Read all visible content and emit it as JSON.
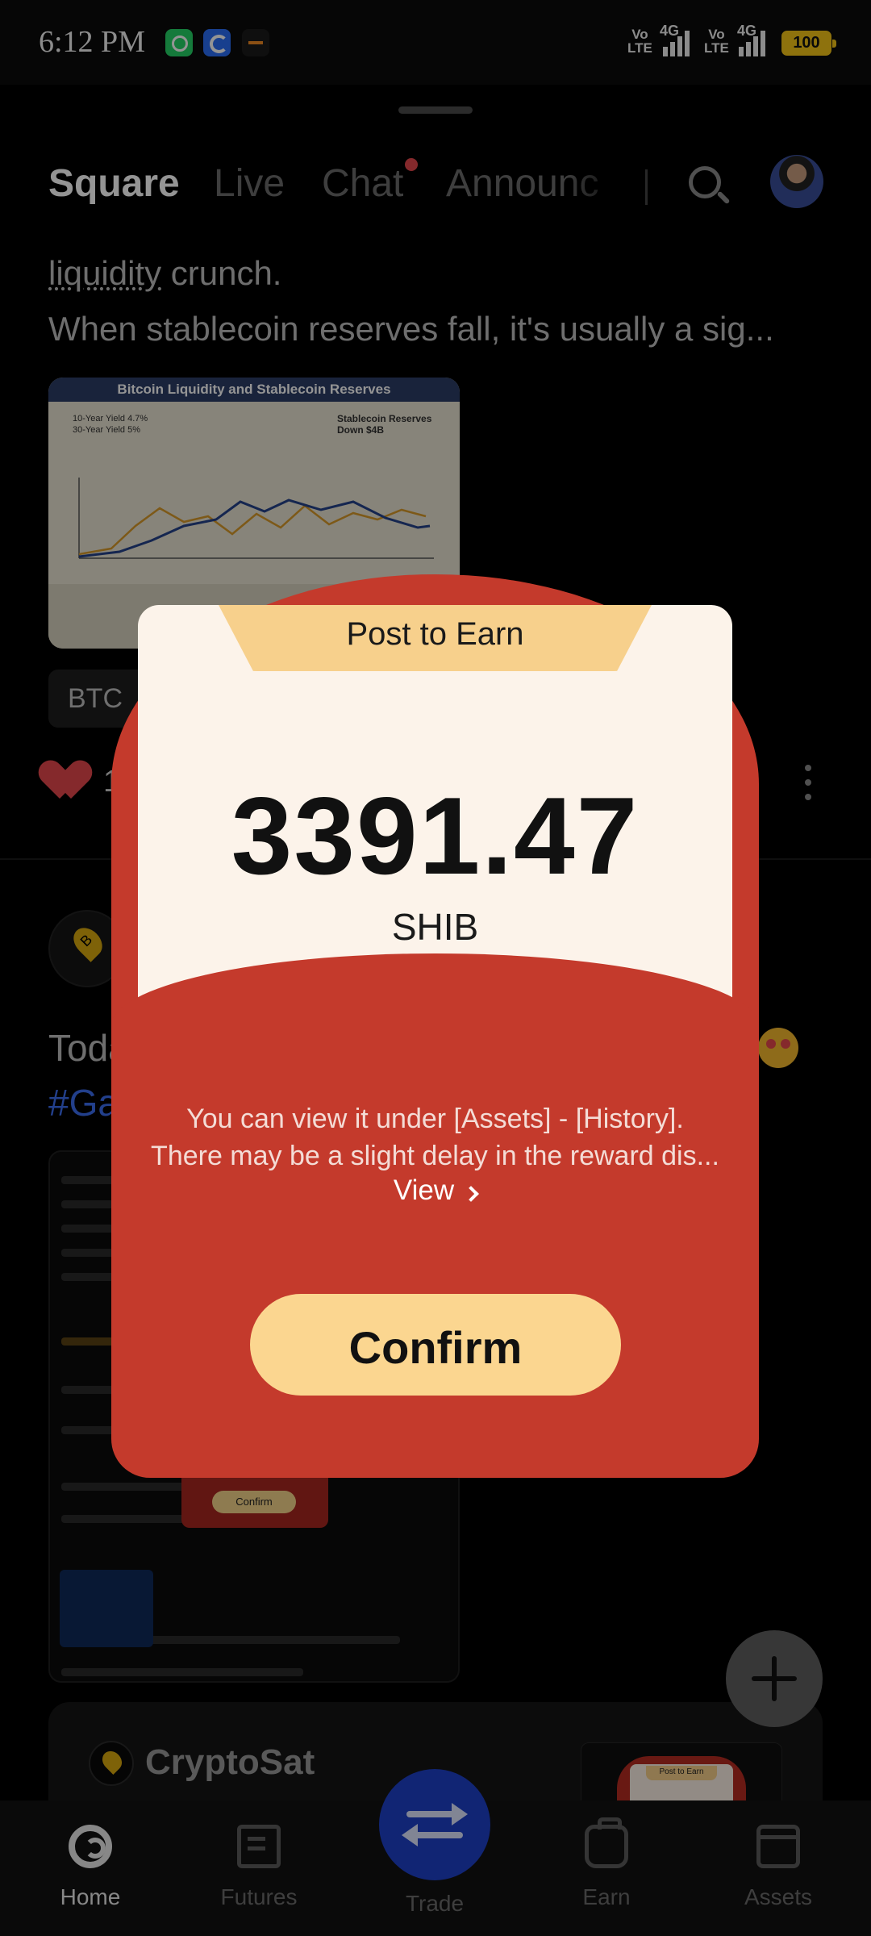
{
  "status_bar": {
    "time": "6:12 PM",
    "net1": "Vo\nLTE",
    "net2": "4G",
    "net3": "Vo\nLTE",
    "net4": "4G",
    "battery": "100"
  },
  "tabs": {
    "square": "Square",
    "live": "Live",
    "chat": "Chat",
    "announcements": "Announc"
  },
  "feed": {
    "post1_line1_underlined": "liquidity",
    "post1_line1_rest": " crunch.",
    "post1_line2": "When stablecoin reserves fall, it's usually a sig...",
    "image_title": "Bitcoin Liquidity and Stablecoin Reserves",
    "image_yields": "10-Year Yield 4.7%\n30-Year Yield 5%",
    "image_reserves": "Stablecoin Reserves\nDown $4B",
    "tag": "BTC",
    "like_count": "10",
    "post2_text": "Toda",
    "post2_hashtag": "#Ga",
    "mini_confirm": "Confirm",
    "card_name": "CryptoSat",
    "card_thumb_title": "Post to Earn"
  },
  "modal": {
    "title": "Post to Earn",
    "amount": "3391.47",
    "coin": "SHIB",
    "info_line1": "You can view it under [Assets] - [History].",
    "info_line2": "There may be a slight delay in the reward dis...",
    "view_label": "View",
    "confirm_label": "Confirm",
    "colors": {
      "envelope": "#c43a2c",
      "letter": "#fcf3ea",
      "tab": "#f7d08c",
      "button": "#fbd690"
    }
  },
  "bottom_nav": {
    "home": "Home",
    "futures": "Futures",
    "trade": "Trade",
    "earn": "Earn",
    "assets": "Assets"
  }
}
